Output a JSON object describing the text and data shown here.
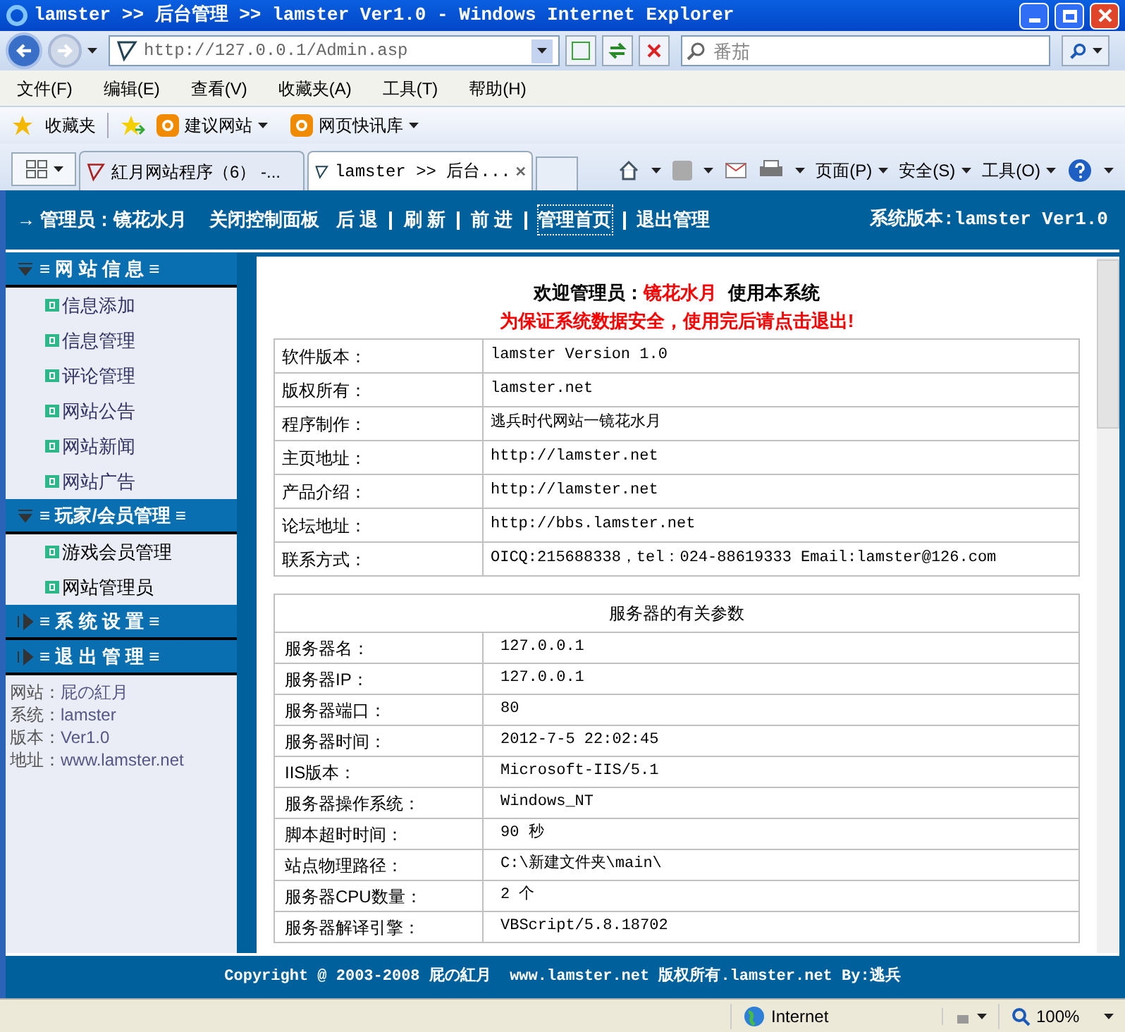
{
  "window": {
    "title": "lamster >> 后台管理 >> lamster Ver1.0 - Windows Internet Explorer"
  },
  "address": {
    "url": "http://127.0.0.1/Admin.asp"
  },
  "search": {
    "placeholder": "番茄"
  },
  "menu": [
    "文件(F)",
    "编辑(E)",
    "查看(V)",
    "收藏夹(A)",
    "工具(T)",
    "帮助(H)"
  ],
  "favorites": {
    "label": "收藏夹",
    "links": [
      "建议网站",
      "网页快讯库"
    ]
  },
  "tabs": [
    {
      "label": "紅月网站程序（6） -...",
      "selected": false
    },
    {
      "label": "lamster >> 后台...",
      "selected": true
    }
  ],
  "command_bar": [
    "页面(P)",
    "安全(S)",
    "工具(O)"
  ],
  "header": {
    "nav": [
      {
        "label": "→ 管理员：镜花水月",
        "selected": false
      },
      {
        "label": "关闭控制面板",
        "selected": false
      },
      {
        "label": "后 退",
        "selected": false
      },
      {
        "label": "刷 新",
        "selected": false
      },
      {
        "label": "前 进",
        "selected": false
      },
      {
        "label": "管理首页",
        "selected": true
      },
      {
        "label": "退出管理",
        "selected": false
      }
    ],
    "version": "系统版本:lamster Ver1.0"
  },
  "sidebar": {
    "sections": [
      {
        "title": "≡ 网 站 信 息 ≡",
        "expanded": true,
        "items": [
          "信息添加",
          "信息管理",
          "评论管理",
          "网站公告",
          "网站新闻",
          "网站广告"
        ]
      },
      {
        "title": "≡ 玩家/会员管理 ≡",
        "expanded": true,
        "items": [
          "游戏会员管理",
          "网站管理员"
        ]
      },
      {
        "title": "≡ 系 统 设 置 ≡",
        "expanded": false
      },
      {
        "title": "≡ 退 出 管 理 ≡",
        "expanded": false
      }
    ],
    "info": [
      {
        "label": "网站：",
        "value": "屁の紅月"
      },
      {
        "label": "系统：",
        "value": "lamster"
      },
      {
        "label": "版本：",
        "value": "Ver1.0"
      },
      {
        "label": "地址：",
        "value": "www.lamster.net"
      }
    ]
  },
  "welcome": {
    "prefix": "欢迎管理员：",
    "name": "镜花水月",
    "suffix": "使用本系统",
    "warning": "为保证系统数据安全，使用完后请点击退出!"
  },
  "info_table": [
    {
      "label": "软件版本：",
      "value": "lamster Version 1.0"
    },
    {
      "label": "版权所有：",
      "value": "lamster.net"
    },
    {
      "label": "程序制作：",
      "value": "逃兵时代网站一镜花水月"
    },
    {
      "label": "主页地址：",
      "value": "http://lamster.net"
    },
    {
      "label": "产品介绍：",
      "value": "http://lamster.net"
    },
    {
      "label": "论坛地址：",
      "value": "http://bbs.lamster.net"
    },
    {
      "label": "联系方式：",
      "value": "OICQ:215688338，tel：024-88619333 Email:lamster@126.com"
    }
  ],
  "server_table": {
    "title": "服务器的有关参数",
    "rows": [
      {
        "label": "服务器名：",
        "value": "127.0.0.1"
      },
      {
        "label": "服务器IP：",
        "value": "127.0.0.1"
      },
      {
        "label": "服务器端口：",
        "value": "80"
      },
      {
        "label": "服务器时间：",
        "value": "2012-7-5 22:02:45"
      },
      {
        "label": "IIS版本：",
        "value": "Microsoft-IIS/5.1"
      },
      {
        "label": "服务器操作系统：",
        "value": "Windows_NT"
      },
      {
        "label": "脚本超时时间：",
        "value": "90 秒"
      },
      {
        "label": "站点物理路径：",
        "value": "C:\\新建文件夹\\main\\"
      },
      {
        "label": "服务器CPU数量：",
        "value": "2 个"
      },
      {
        "label": "服务器解译引擎：",
        "value": "VBScript/5.8.18702"
      }
    ]
  },
  "footer": "Copyright @ 2003-2008 屁の紅月  www.lamster.net 版权所有.lamster.net By:逃兵",
  "status": {
    "zone": "Internet",
    "zoom": "100%"
  }
}
